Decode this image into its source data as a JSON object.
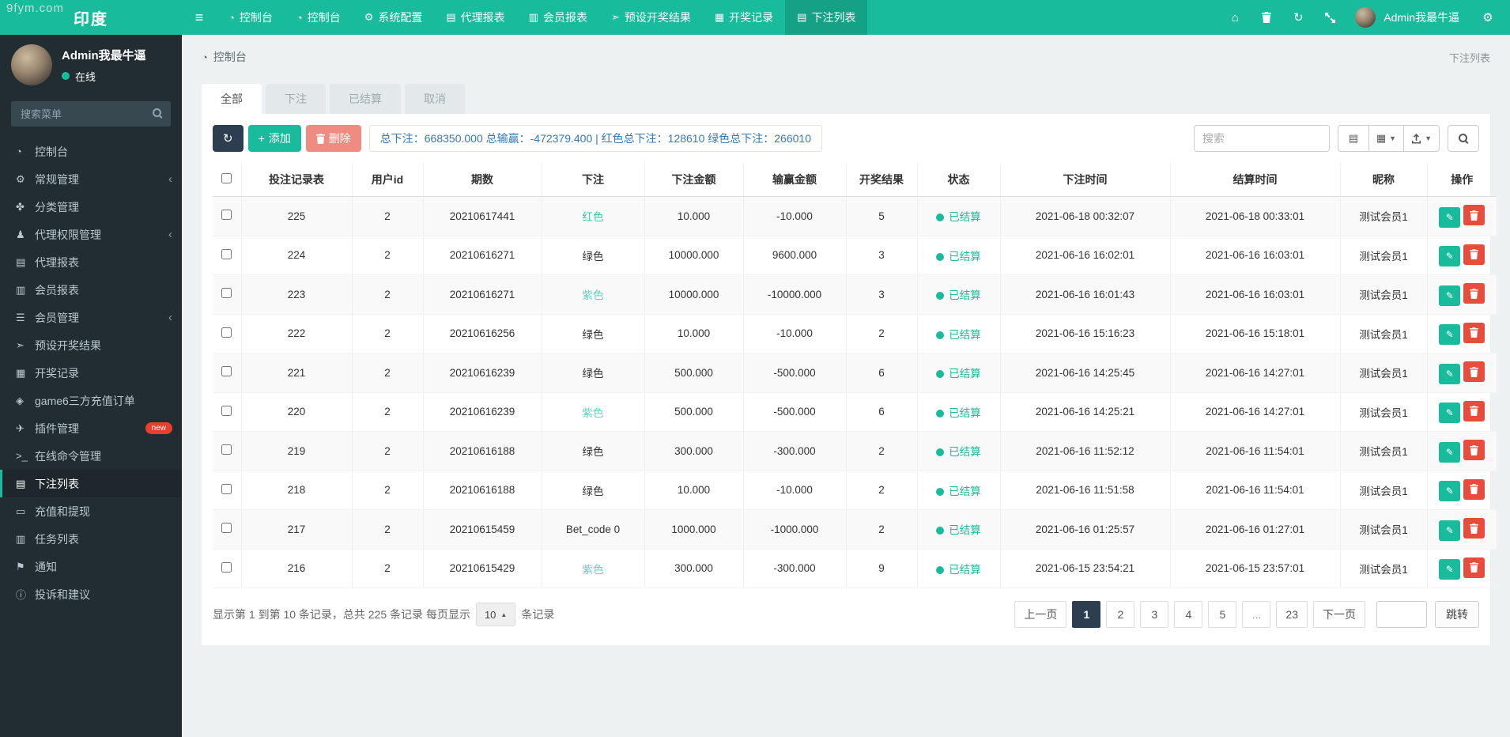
{
  "watermark": "9fym.com",
  "navbar": {
    "brand": "印度",
    "items": [
      {
        "label": "控制台",
        "icon": "dashboard-icon",
        "glyph": "◔"
      },
      {
        "label": "控制台",
        "icon": "dashboard-icon",
        "glyph": "◔"
      },
      {
        "label": "系统配置",
        "icon": "gear-icon",
        "glyph": "⚙"
      },
      {
        "label": "代理报表",
        "icon": "agent-report-icon",
        "glyph": "▤"
      },
      {
        "label": "会员报表",
        "icon": "member-report-icon",
        "glyph": "▥"
      },
      {
        "label": "预设开奖结果",
        "icon": "preset-result-icon",
        "glyph": "➣"
      },
      {
        "label": "开奖记录",
        "icon": "draw-record-icon",
        "glyph": "▦"
      },
      {
        "label": "下注列表",
        "icon": "bet-list-icon",
        "glyph": "▤",
        "active": true
      }
    ],
    "tools": [
      {
        "name": "home-icon",
        "glyph": "⌂"
      },
      {
        "name": "trash-icon",
        "glyph": "trash-svg"
      },
      {
        "name": "history-icon",
        "glyph": "↻"
      },
      {
        "name": "fullscreen-icon",
        "glyph": "expand-svg"
      }
    ],
    "user": "Admin我最牛逼",
    "settings_icon": "⚙"
  },
  "sidebar": {
    "user": {
      "name": "Admin我最牛逼",
      "status": "在线"
    },
    "search_placeholder": "搜索菜单",
    "items": [
      {
        "label": "控制台",
        "icon": "dashboard-icon",
        "glyph": "◔"
      },
      {
        "label": "常规管理",
        "icon": "settings-icon",
        "glyph": "⚙",
        "chevron": true
      },
      {
        "label": "分类管理",
        "icon": "category-icon",
        "glyph": "✤"
      },
      {
        "label": "代理权限管理",
        "icon": "agent-permission-icon",
        "glyph": "♟",
        "chevron": true
      },
      {
        "label": "代理报表",
        "icon": "agent-report-icon",
        "glyph": "▤"
      },
      {
        "label": "会员报表",
        "icon": "member-report-icon",
        "glyph": "▥"
      },
      {
        "label": "会员管理",
        "icon": "member-manage-icon",
        "glyph": "☰",
        "chevron": true
      },
      {
        "label": "预设开奖结果",
        "icon": "preset-result-icon",
        "glyph": "➣"
      },
      {
        "label": "开奖记录",
        "icon": "draw-record-icon",
        "glyph": "▦"
      },
      {
        "label": "game6三方充值订单",
        "icon": "gem-icon",
        "glyph": "◈"
      },
      {
        "label": "插件管理",
        "icon": "plugin-icon",
        "glyph": "✈",
        "badge": "new"
      },
      {
        "label": "在线命令管理",
        "icon": "terminal-icon",
        "glyph": ">_"
      },
      {
        "label": "下注列表",
        "icon": "bet-list-icon",
        "glyph": "▤",
        "active": true
      },
      {
        "label": "充值和提现",
        "icon": "money-icon",
        "glyph": "▭"
      },
      {
        "label": "任务列表",
        "icon": "task-list-icon",
        "glyph": "▥"
      },
      {
        "label": "通知",
        "icon": "notice-icon",
        "glyph": "⚑"
      },
      {
        "label": "投诉和建议",
        "icon": "feedback-icon",
        "glyph": "ⓘ"
      }
    ]
  },
  "breadcrumb": {
    "left": "控制台",
    "right": "下注列表"
  },
  "tabs": [
    {
      "label": "全部",
      "active": true
    },
    {
      "label": "下注"
    },
    {
      "label": "已结算"
    },
    {
      "label": "取消"
    }
  ],
  "toolbar": {
    "add_label": "添加",
    "delete_label": "删除",
    "summary": "总下注：668350.000 总输赢：-472379.400 | 红色总下注：128610 绿色总下注：266010",
    "search_placeholder": "搜索"
  },
  "colors": {
    "accent_teal": "#18bc9c",
    "navy": "#2c3e50",
    "red": "#e74c3c",
    "summary_text": "#337ab7",
    "bet_red_text": "#3bc8a8",
    "bet_purple_text": "#5fd3c2"
  },
  "table": {
    "columns": [
      "投注记录表",
      "用户id",
      "期数",
      "下注",
      "下注金额",
      "输赢金额",
      "开奖结果",
      "状态",
      "下注时间",
      "结算时间",
      "昵称",
      "操作"
    ],
    "rows": [
      {
        "id": "225",
        "uid": "2",
        "issue": "20210617441",
        "bet": "红色",
        "bet_class": "red",
        "amount": "10.000",
        "winloss": "-10.000",
        "result": "5",
        "status": "已结算",
        "bet_time": "2021-06-18 00:32:07",
        "settle_time": "2021-06-18 00:33:01",
        "nick": "测试会员1"
      },
      {
        "id": "224",
        "uid": "2",
        "issue": "20210616271",
        "bet": "绿色",
        "bet_class": "green",
        "amount": "10000.000",
        "winloss": "9600.000",
        "result": "3",
        "status": "已结算",
        "bet_time": "2021-06-16 16:02:01",
        "settle_time": "2021-06-16 16:03:01",
        "nick": "测试会员1"
      },
      {
        "id": "223",
        "uid": "2",
        "issue": "20210616271",
        "bet": "紫色",
        "bet_class": "purple",
        "amount": "10000.000",
        "winloss": "-10000.000",
        "result": "3",
        "status": "已结算",
        "bet_time": "2021-06-16 16:01:43",
        "settle_time": "2021-06-16 16:03:01",
        "nick": "测试会员1"
      },
      {
        "id": "222",
        "uid": "2",
        "issue": "20210616256",
        "bet": "绿色",
        "bet_class": "green",
        "amount": "10.000",
        "winloss": "-10.000",
        "result": "2",
        "status": "已结算",
        "bet_time": "2021-06-16 15:16:23",
        "settle_time": "2021-06-16 15:18:01",
        "nick": "测试会员1"
      },
      {
        "id": "221",
        "uid": "2",
        "issue": "20210616239",
        "bet": "绿色",
        "bet_class": "green",
        "amount": "500.000",
        "winloss": "-500.000",
        "result": "6",
        "status": "已结算",
        "bet_time": "2021-06-16 14:25:45",
        "settle_time": "2021-06-16 14:27:01",
        "nick": "测试会员1"
      },
      {
        "id": "220",
        "uid": "2",
        "issue": "20210616239",
        "bet": "紫色",
        "bet_class": "purple",
        "amount": "500.000",
        "winloss": "-500.000",
        "result": "6",
        "status": "已结算",
        "bet_time": "2021-06-16 14:25:21",
        "settle_time": "2021-06-16 14:27:01",
        "nick": "测试会员1"
      },
      {
        "id": "219",
        "uid": "2",
        "issue": "20210616188",
        "bet": "绿色",
        "bet_class": "green",
        "amount": "300.000",
        "winloss": "-300.000",
        "result": "2",
        "status": "已结算",
        "bet_time": "2021-06-16 11:52:12",
        "settle_time": "2021-06-16 11:54:01",
        "nick": "测试会员1"
      },
      {
        "id": "218",
        "uid": "2",
        "issue": "20210616188",
        "bet": "绿色",
        "bet_class": "green",
        "amount": "10.000",
        "winloss": "-10.000",
        "result": "2",
        "status": "已结算",
        "bet_time": "2021-06-16 11:51:58",
        "settle_time": "2021-06-16 11:54:01",
        "nick": "测试会员1"
      },
      {
        "id": "217",
        "uid": "2",
        "issue": "20210615459",
        "bet": "Bet_code 0",
        "bet_class": "green",
        "amount": "1000.000",
        "winloss": "-1000.000",
        "result": "2",
        "status": "已结算",
        "bet_time": "2021-06-16 01:25:57",
        "settle_time": "2021-06-16 01:27:01",
        "nick": "测试会员1"
      },
      {
        "id": "216",
        "uid": "2",
        "issue": "20210615429",
        "bet": "紫色",
        "bet_class": "purple",
        "amount": "300.000",
        "winloss": "-300.000",
        "result": "9",
        "status": "已结算",
        "bet_time": "2021-06-15 23:54:21",
        "settle_time": "2021-06-15 23:57:01",
        "nick": "测试会员1"
      }
    ]
  },
  "footer": {
    "info_prefix": "显示第 1 到第 10 条记录，总共 225 条记录 每页显示",
    "page_size": "10",
    "info_suffix": "条记录",
    "pages": [
      {
        "label": "上一页"
      },
      {
        "label": "1",
        "active": true
      },
      {
        "label": "2"
      },
      {
        "label": "3"
      },
      {
        "label": "4"
      },
      {
        "label": "5"
      },
      {
        "label": "...",
        "ellipsis": true
      },
      {
        "label": "23"
      },
      {
        "label": "下一页"
      }
    ],
    "jump_label": "跳转"
  }
}
